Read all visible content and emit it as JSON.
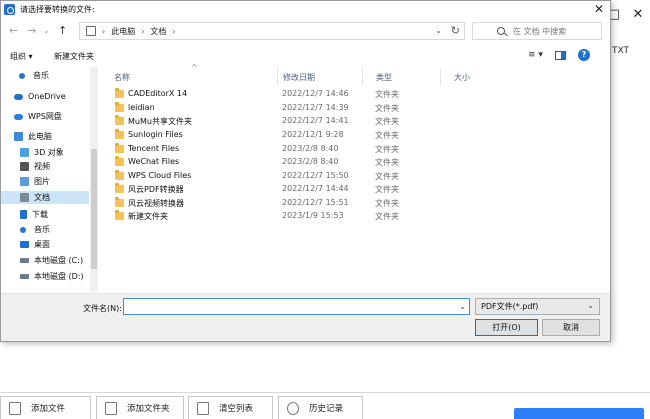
{
  "background_app": {
    "side_text": "TXT",
    "window_controls": [
      "□",
      "✕"
    ],
    "bottom_buttons": [
      {
        "label": "添加文件"
      },
      {
        "label": "添加文件夹"
      },
      {
        "label": "清空列表"
      },
      {
        "label": "历史记录"
      }
    ],
    "accent_color": "#2d7ff9"
  },
  "dialog": {
    "title": "请选择要转换的文件:",
    "close": "✕",
    "nav": {
      "back": "←",
      "forward": "→",
      "dropdown": "⌄",
      "up": "↑"
    },
    "address": {
      "segments": [
        "此电脑",
        "文档"
      ],
      "separator": "›",
      "dropdown": "⌄",
      "refresh": "↻"
    },
    "search": {
      "placeholder": "在 文档 中搜索"
    },
    "toolbar": {
      "organize": "组织 ▾",
      "new_folder": "新建文件夹",
      "view": "≡ ▾",
      "help": "?"
    },
    "nav_pane": [
      {
        "label": "音乐",
        "icon": "music-icon",
        "color": "#2b6fd1"
      },
      {
        "label": "OneDrive",
        "icon": "cloud-icon",
        "color": "#1f6fd1"
      },
      {
        "label": "WPS网盘",
        "icon": "cloud-icon",
        "color": "#2a7de1"
      },
      {
        "label": "此电脑",
        "icon": "computer-icon",
        "color": "#3b8bd9"
      },
      {
        "label": "3D 对象",
        "icon": "cube-icon",
        "color": "#4aa3e0"
      },
      {
        "label": "视频",
        "icon": "video-icon",
        "color": "#555555"
      },
      {
        "label": "图片",
        "icon": "picture-icon",
        "color": "#5b9bd5"
      },
      {
        "label": "文档",
        "icon": "document-icon",
        "color": "#7a8a99",
        "selected": true
      },
      {
        "label": "下载",
        "icon": "download-icon",
        "color": "#1f6fd1"
      },
      {
        "label": "音乐",
        "icon": "music-icon",
        "color": "#2b6fd1"
      },
      {
        "label": "桌面",
        "icon": "desktop-icon",
        "color": "#1f6fd1"
      },
      {
        "label": "本地磁盘 (C:)",
        "icon": "drive-icon",
        "color": "#6b7b8a"
      },
      {
        "label": "本地磁盘 (D:)",
        "icon": "drive-icon",
        "color": "#6b7b8a"
      }
    ],
    "columns": [
      "名称",
      "修改日期",
      "类型",
      "大小"
    ],
    "sort_indicator": "^",
    "files": [
      {
        "name": "CADEditorX 14",
        "date": "2022/12/7 14:46",
        "type": "文件夹"
      },
      {
        "name": "leidian",
        "date": "2022/12/7 14:39",
        "type": "文件夹"
      },
      {
        "name": "MuMu共享文件夹",
        "date": "2022/12/7 14:41",
        "type": "文件夹"
      },
      {
        "name": "Sunlogin Files",
        "date": "2022/12/1 9:28",
        "type": "文件夹"
      },
      {
        "name": "Tencent Files",
        "date": "2023/2/8 8:40",
        "type": "文件夹"
      },
      {
        "name": "WeChat Files",
        "date": "2023/2/8 8:40",
        "type": "文件夹"
      },
      {
        "name": "WPS Cloud Files",
        "date": "2022/12/7 15:50",
        "type": "文件夹"
      },
      {
        "name": "风云PDF转换器",
        "date": "2022/12/7 14:44",
        "type": "文件夹"
      },
      {
        "name": "风云视频转换器",
        "date": "2022/12/7 15:51",
        "type": "文件夹"
      },
      {
        "name": "新建文件夹",
        "date": "2023/1/9 15:53",
        "type": "文件夹"
      }
    ],
    "filename": {
      "label": "文件名(N):",
      "value": "",
      "dropdown": "⌄"
    },
    "filetype": {
      "value": "PDF文件(*.pdf)",
      "dropdown": "⌄"
    },
    "open_button": "打开(O)",
    "cancel_button": "取消"
  }
}
